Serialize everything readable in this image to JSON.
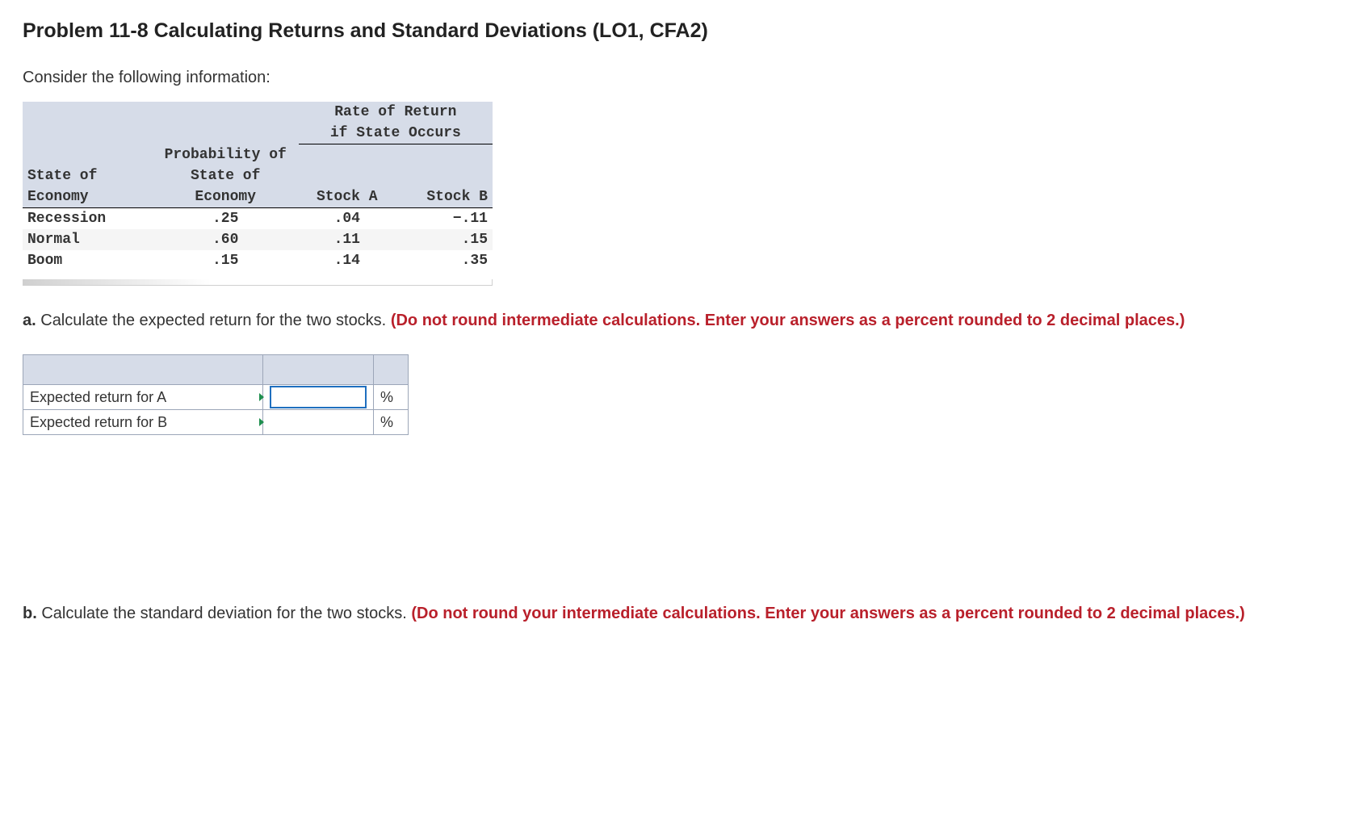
{
  "title": "Problem 11-8 Calculating Returns and Standard Deviations (LO1, CFA2)",
  "intro": "Consider the following information:",
  "table": {
    "rate_header": "Rate of Return if State Occurs",
    "rate_header_line1": "Rate of Return",
    "rate_header_line2": "if State Occurs",
    "col_state": "State of Economy",
    "col_state_line1": "State of",
    "col_state_line2": "Economy",
    "col_prob": "Probability of State of Economy",
    "col_prob_line1": "Probability of",
    "col_prob_line2": "State of",
    "col_prob_line3": "Economy",
    "col_stockA": "Stock A",
    "col_stockB": "Stock B",
    "rows": [
      {
        "state": "Recession",
        "prob": ".25",
        "a": ".04",
        "b": "−.11"
      },
      {
        "state": "Normal",
        "prob": ".60",
        "a": ".11",
        "b": ".15"
      },
      {
        "state": "Boom",
        "prob": ".15",
        "a": ".14",
        "b": ".35"
      }
    ]
  },
  "chart_data": {
    "type": "table",
    "title": "Rate of Return if State Occurs",
    "columns": [
      "State of Economy",
      "Probability of State of Economy",
      "Stock A",
      "Stock B"
    ],
    "rows": [
      [
        "Recession",
        0.25,
        0.04,
        -0.11
      ],
      [
        "Normal",
        0.6,
        0.11,
        0.15
      ],
      [
        "Boom",
        0.15,
        0.14,
        0.35
      ]
    ]
  },
  "question_a": {
    "label": "a.",
    "text_black": " Calculate the expected return for the two stocks. ",
    "text_red": "(Do not round intermediate calculations. Enter your answers as a percent rounded to 2 decimal places.)"
  },
  "answer_table": {
    "rows": [
      {
        "label": "Expected return for A",
        "value": "",
        "unit": "%"
      },
      {
        "label": "Expected return for B",
        "value": "",
        "unit": "%"
      }
    ]
  },
  "question_b": {
    "label": "b.",
    "text_black": " Calculate the standard deviation for the two stocks. ",
    "text_red": "(Do not round your intermediate calculations. Enter your answers as a percent rounded to 2 decimal places.)"
  }
}
